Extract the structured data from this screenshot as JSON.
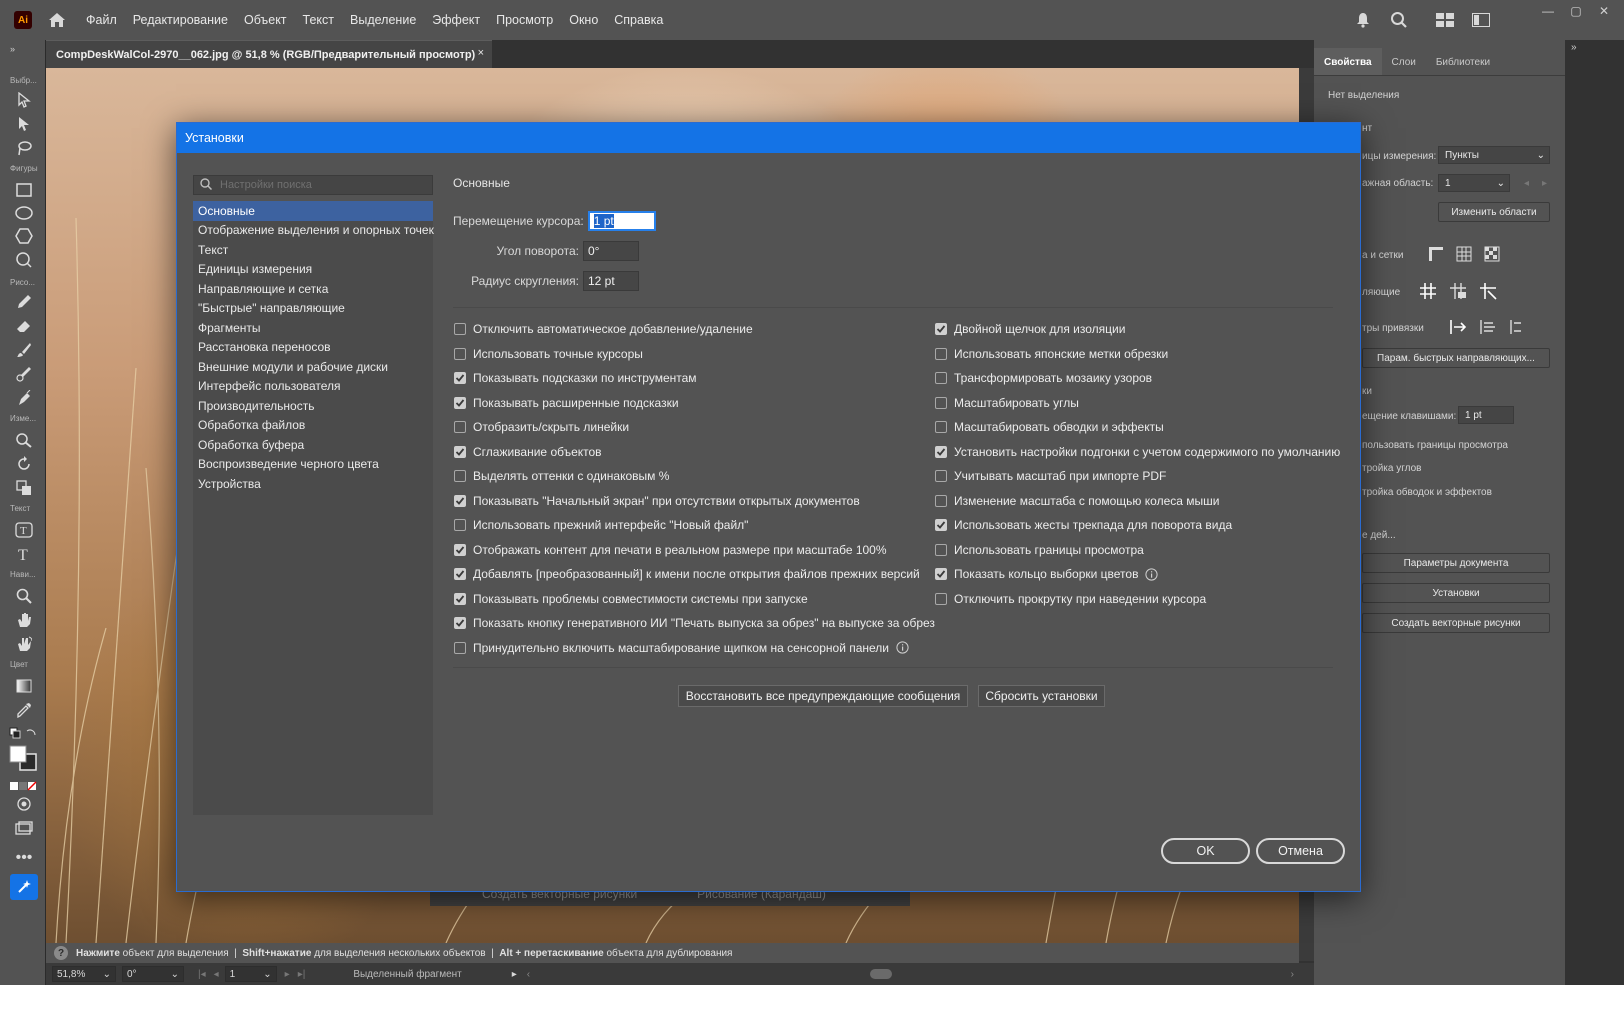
{
  "app": {
    "logo": "Ai",
    "menu": [
      "Файл",
      "Редактирование",
      "Объект",
      "Текст",
      "Выделение",
      "Эффект",
      "Просмотр",
      "Окно",
      "Справка"
    ]
  },
  "document": {
    "tab_title": "CompDeskWalCol-2970__062.jpg @ 51,8 % (RGB/Предварительный просмотр)",
    "close": "×"
  },
  "toolbar": {
    "labels": [
      "Выбр...",
      "Фигуры",
      "Рисо...",
      "Изме...",
      "Текст",
      "Нави...",
      "Цвет"
    ]
  },
  "statusbar": {
    "help": "?",
    "hint_part1_bold": "Нажмите",
    "hint_part1": "объект для выделения",
    "hint_part2_bold": "Shift+нажатие",
    "hint_part2": "для выделения нескольких объектов",
    "hint_part3_bold": "Alt + перетаскивание",
    "hint_part3": "объекта для дублирования",
    "zoom": "51,8%",
    "rotation": "0°",
    "page": "1",
    "selection": "Выделенный фрагмент"
  },
  "ghost_bar": {
    "left": "Создать векторные рисунки",
    "right": "Рисование (Карандаш)"
  },
  "right_panel": {
    "tabs": [
      "Свойства",
      "Слои",
      "Библиотеки"
    ],
    "no_selection": "Нет выделения",
    "doc_label": "нт",
    "units_label": "ицы измерения:",
    "units_value": "Пункты",
    "artboard_label": "ажная область:",
    "artboard_value": "1",
    "edit_artboards": "Изменить области",
    "rulers_label": "а и сетки",
    "guides_label": "ляющие",
    "snap_label": "тры привязки",
    "smart_guides_btn": "Парам. быстрых направляющих...",
    "keyboard_label": "ки",
    "keyboard_increment_label": "ещение клавишами:",
    "keyboard_increment_value": "1 pt",
    "preview_bounds": "пользовать границы просмотра",
    "scale_corners": "тройка углов",
    "scale_strokes": "тройка обводок и эффектов",
    "quick_actions": "е дей...",
    "doc_setup_btn": "Параметры документа",
    "prefs_btn": "Установки",
    "vectorize_btn": "Создать векторные рисунки"
  },
  "dialog": {
    "title": "Установки",
    "search_placeholder": "Настройки поиска",
    "nav": [
      "Основные",
      "Отображение выделения и опорных точек",
      "Текст",
      "Единицы измерения",
      "Направляющие и сетка",
      "\"Быстрые\" направляющие",
      "Фрагменты",
      "Расстановка переносов",
      "Внешние модули и рабочие диски",
      "Интерфейс пользователя",
      "Производительность",
      "Обработка файлов",
      "Обработка буфера",
      "Воспроизведение черного цвета",
      "Устройства"
    ],
    "section_title": "Основные",
    "keyboard_increment_label": "Перемещение курсора:",
    "keyboard_increment_value": "1 pt",
    "constrain_angle_label": "Угол поворота:",
    "constrain_angle_value": "0°",
    "corner_radius_label": "Радиус скругления:",
    "corner_radius_value": "12 pt",
    "left_checkboxes": [
      {
        "label": "Отключить автоматическое добавление/удаление",
        "checked": false
      },
      {
        "label": "Использовать точные курсоры",
        "checked": false
      },
      {
        "label": "Показывать подсказки по инструментам",
        "checked": true
      },
      {
        "label": "Показывать расширенные подсказки",
        "checked": true
      },
      {
        "label": "Отобразить/скрыть линейки",
        "checked": false
      },
      {
        "label": "Сглаживание объектов",
        "checked": true
      },
      {
        "label": "Выделять оттенки с одинаковым %",
        "checked": false
      },
      {
        "label": "Показывать \"Начальный экран\" при отсутствии открытых документов",
        "checked": true
      },
      {
        "label": "Использовать прежний интерфейс \"Новый файл\"",
        "checked": false
      },
      {
        "label": "Отображать контент для печати в реальном размере при масштабе 100%",
        "checked": true
      },
      {
        "label": "Добавлять [преобразованный] к имени после открытия файлов прежних версий",
        "checked": true
      },
      {
        "label": "Показывать проблемы совместимости системы при запуске",
        "checked": true
      },
      {
        "label": "Показать кнопку генеративного ИИ \"Печать выпуска за обрез\" на выпуске за обрез",
        "checked": true
      },
      {
        "label": "Принудительно включить масштабирование щипком на сенсорной панели",
        "checked": false,
        "info": true
      }
    ],
    "right_checkboxes": [
      {
        "label": "Двойной щелчок для изоляции",
        "checked": true
      },
      {
        "label": "Использовать японские метки обрезки",
        "checked": false
      },
      {
        "label": "Трансформировать мозаику узоров",
        "checked": false
      },
      {
        "label": "Масштабировать углы",
        "checked": false
      },
      {
        "label": "Масштабировать обводки и эффекты",
        "checked": false
      },
      {
        "label": "Установить настройки подгонки с учетом содержимого по умолчанию",
        "checked": true
      },
      {
        "label": "Учитывать масштаб при импорте PDF",
        "checked": false
      },
      {
        "label": "Изменение масштаба с помощью колеса мыши",
        "checked": false
      },
      {
        "label": "Использовать жесты трекпада для поворота вида",
        "checked": true
      },
      {
        "label": "Использовать границы просмотра",
        "checked": false
      },
      {
        "label": "Показать кольцо выборки цветов",
        "checked": true,
        "info": true
      },
      {
        "label": "Отключить прокрутку при наведении курсора",
        "checked": false
      }
    ],
    "reset_warnings_btn": "Восстановить все предупреждающие сообщения",
    "reset_prefs_btn": "Сбросить установки",
    "ok_btn": "OK",
    "cancel_btn": "Отмена"
  },
  "colors": {
    "accent": "#1473e6",
    "panel": "#535353",
    "dialog_bg": "#535353",
    "nav_selected": "#3d62a0"
  }
}
